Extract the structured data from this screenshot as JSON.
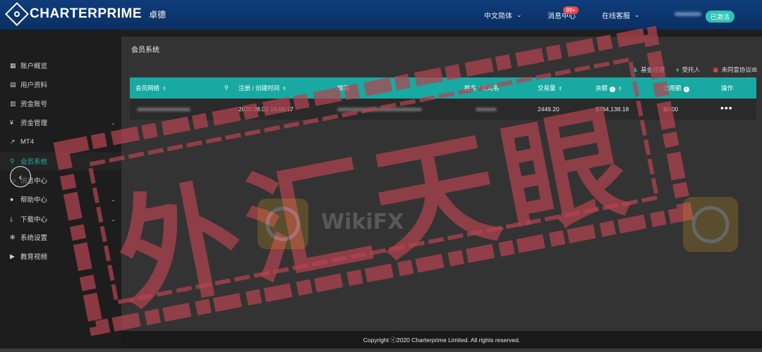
{
  "header": {
    "brand": "CHARTERPRIME",
    "brand_cn": "卓德",
    "language": "中文简体",
    "messages": "消息中心",
    "messages_badge": "99+",
    "support": "在线客服",
    "status": "已激活"
  },
  "sidebar": {
    "items": [
      {
        "label": "账户概览",
        "icon": "grid-icon"
      },
      {
        "label": "用户资料",
        "icon": "profile-icon"
      },
      {
        "label": "资金账号",
        "icon": "ledger-icon"
      },
      {
        "label": "资金管理",
        "icon": "money-icon"
      },
      {
        "label": "MT4",
        "icon": "chart-icon"
      },
      {
        "label": "会员系统",
        "icon": "tree-icon"
      },
      {
        "label": "消息中心",
        "icon": "message-icon"
      },
      {
        "label": "帮助中心",
        "icon": "help-icon"
      },
      {
        "label": "下载中心",
        "icon": "download-icon"
      },
      {
        "label": "系统设置",
        "icon": "settings-icon"
      },
      {
        "label": "教育视频",
        "icon": "video-icon"
      }
    ]
  },
  "main": {
    "title": "会员系统",
    "actions": {
      "fund_manager": "基金经理",
      "trustee": "受托人",
      "unagreed": "未同意协议IB"
    },
    "table": {
      "headers": {
        "member_network": "会员网络",
        "reg_time": "注册 / 创建时间",
        "email": "邮箱",
        "name": "姓名 / 公司名",
        "volume": "交易量",
        "balance": "余额",
        "credit": "信用额",
        "actions": "操作"
      },
      "rows": [
        {
          "reg_time": "2020.08.02 14:06:17",
          "volume": "2449.20",
          "balance": "$764,138.18",
          "credit": "$0.00",
          "more": "•••"
        }
      ]
    }
  },
  "footer": {
    "copyright": "Copyright ⓒ2020 Charterprime Limited. All rights reserved."
  },
  "watermark": {
    "stamp_text": "外汇天眼",
    "brand": "WikiFX"
  },
  "colors": {
    "header_bg": "#0a2f63",
    "accent_teal": "#18a9a2",
    "badge_red": "#e5484d",
    "stamp_red": "#b5434f"
  }
}
